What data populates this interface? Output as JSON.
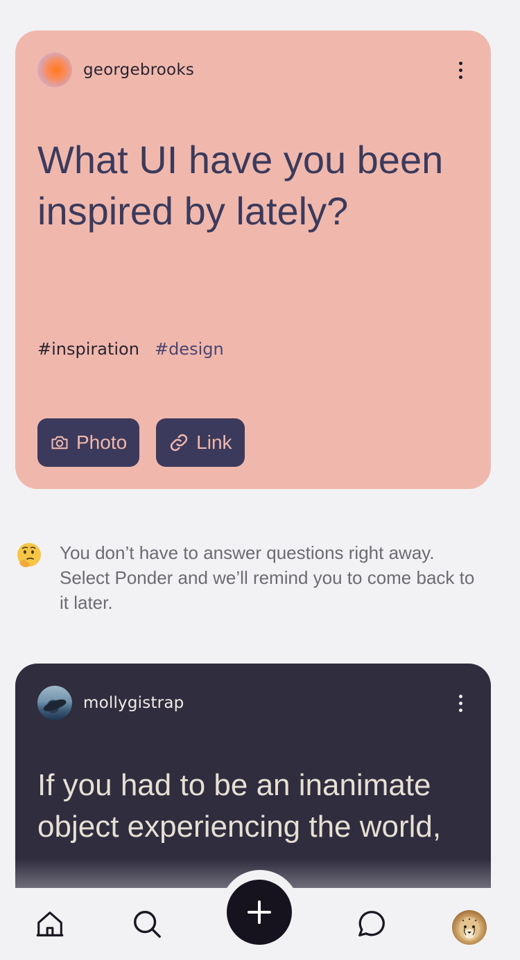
{
  "posts": [
    {
      "username": "georgebrooks",
      "question": "What UI have you been inspired by lately?",
      "tags": [
        "#inspiration",
        "#design"
      ],
      "actions": {
        "photo_label": "Photo",
        "link_label": "Link"
      },
      "background": "#f0b8ad",
      "avatar_icon": "gradient-avatar"
    },
    {
      "username": "mollygistrap",
      "question": "If you had to be an inanimate object experiencing the world,",
      "background": "#302d3f",
      "avatar_icon": "whale-avatar"
    }
  ],
  "tip": {
    "emoji": "thinking-face-icon",
    "text": "You don’t have to answer questions right away. Select Ponder and we’ll remind you to come back to it later."
  },
  "nav": {
    "items": [
      "home-icon",
      "search-icon",
      "add-icon",
      "chat-icon",
      "profile-avatar"
    ]
  },
  "colors": {
    "accent": "#3b3a5c",
    "pink_card": "#f0b8ad",
    "dark_card": "#302d3f",
    "fab": "#16131f"
  }
}
